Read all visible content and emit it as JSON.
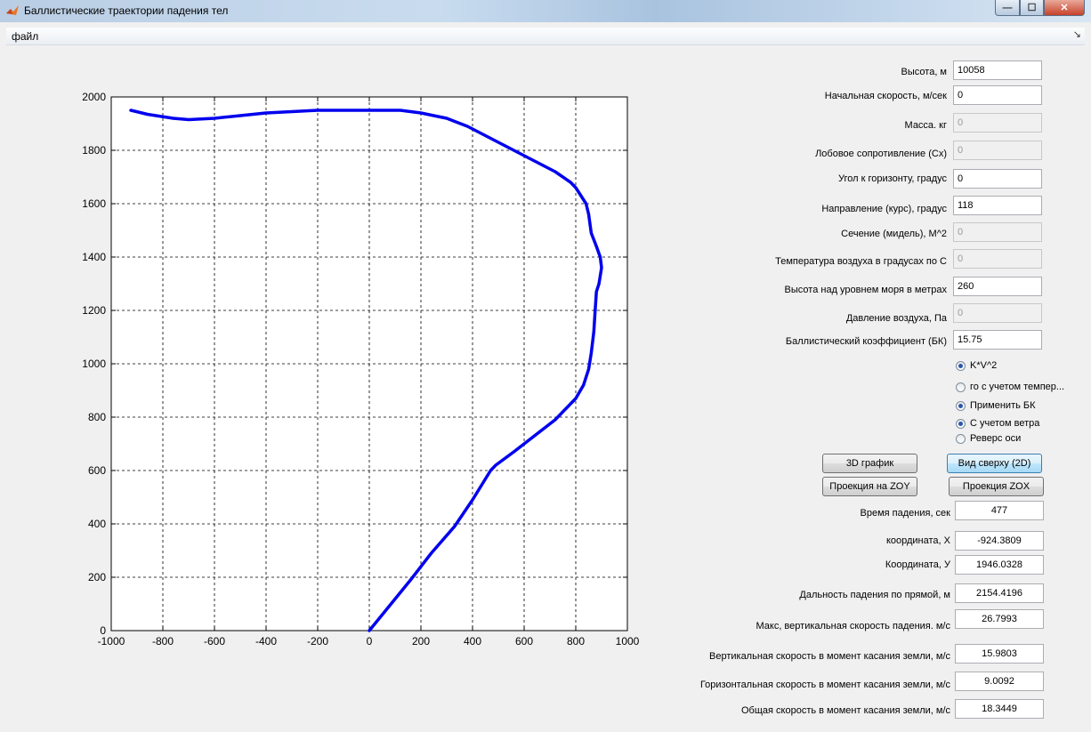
{
  "window": {
    "title": "Баллистические траектории падения тел"
  },
  "menu": {
    "file": "файл",
    "arrow": "↘"
  },
  "icons": {
    "app": "matlab-icon",
    "minimize": "minimize-icon",
    "maximize": "maximize-icon",
    "close": "close-icon"
  },
  "inputs": [
    {
      "label": "Высота, м",
      "value": "10058",
      "enabled": true
    },
    {
      "label": "Начальная скорость, м/сек",
      "value": "0",
      "enabled": true
    },
    {
      "label": "Масса. кг",
      "value": "0",
      "enabled": false
    },
    {
      "label": "Лобовое сопротивление (Cx)",
      "value": "0",
      "enabled": false
    },
    {
      "label": "Угол к горизонту, градус",
      "value": "0",
      "enabled": true
    },
    {
      "label": "Направление  (курс), градус",
      "value": "118",
      "enabled": true
    },
    {
      "label": "Сечение (мидель), М^2",
      "value": "0",
      "enabled": false
    },
    {
      "label": "Температура воздуха в градусах по С",
      "value": "0",
      "enabled": false
    },
    {
      "label": "Высота над уровнем моря в метрах",
      "value": "260",
      "enabled": true
    },
    {
      "label": "Давление воздуха, Па",
      "value": "0",
      "enabled": false
    },
    {
      "label": "Баллистический коэффициент (БК)",
      "value": "15.75",
      "enabled": true
    }
  ],
  "radios": [
    {
      "label": "K*V^2",
      "checked": true
    },
    {
      "label": "го с учетом темпер...",
      "checked": false
    },
    {
      "label": "Применить БК",
      "checked": true
    },
    {
      "label": "С учетом ветра",
      "checked": true
    },
    {
      "label": "Реверс оси",
      "checked": false
    }
  ],
  "buttons": {
    "plot3d": "3D график",
    "top_view": "Вид сверху (2D)",
    "proj_zoy": "Проекция на ZOY",
    "proj_zox": "Проекция ZOX"
  },
  "outputs": [
    {
      "label": "Время падения, сек",
      "value": "477"
    },
    {
      "label": "координата, X",
      "value": "-924.3809"
    },
    {
      "label": "Координата, У",
      "value": "1946.0328"
    },
    {
      "label": "Дальность падения по прямой, м",
      "value": "2154.4196"
    },
    {
      "label": "Макс,  вертикальная скорость падения. м/с",
      "value": "26.7993"
    },
    {
      "label": "Вертикальная  скорость в момент касания земли, м/с",
      "value": "15.9803"
    },
    {
      "label": "Горизонтальная скорость в момент касания земли, м/с",
      "value": "9.0092"
    },
    {
      "label": "Общая скорость в момент касания земли, м/с",
      "value": "18.3449"
    }
  ],
  "chart_data": {
    "type": "line",
    "xlim": [
      -1000,
      1000
    ],
    "ylim": [
      0,
      2000
    ],
    "xticks": [
      -1000,
      -800,
      -600,
      -400,
      -200,
      0,
      200,
      400,
      600,
      800,
      1000
    ],
    "yticks": [
      0,
      200,
      400,
      600,
      800,
      1000,
      1200,
      1400,
      1600,
      1800,
      2000
    ],
    "grid": true,
    "grid_style": "dashed",
    "line_color": "#0000ee",
    "series": [
      {
        "x": [
          0,
          80,
          160,
          240,
          330,
          400,
          470,
          490,
          560,
          640,
          720,
          760,
          800,
          830,
          850,
          860,
          870,
          875,
          880,
          890,
          900,
          895,
          880,
          860,
          850,
          840,
          800,
          780,
          720,
          640,
          560,
          460,
          380,
          300,
          200,
          120,
          0,
          -200,
          -400,
          -500,
          -600,
          -700,
          -760,
          -860,
          -924
        ],
        "y": [
          0,
          95,
          190,
          290,
          390,
          490,
          600,
          620,
          670,
          730,
          790,
          830,
          870,
          920,
          980,
          1040,
          1120,
          1200,
          1270,
          1300,
          1360,
          1400,
          1440,
          1490,
          1560,
          1600,
          1660,
          1680,
          1720,
          1760,
          1800,
          1850,
          1890,
          1920,
          1940,
          1950,
          1950,
          1950,
          1940,
          1930,
          1920,
          1915,
          1920,
          1935,
          1950
        ]
      }
    ]
  }
}
